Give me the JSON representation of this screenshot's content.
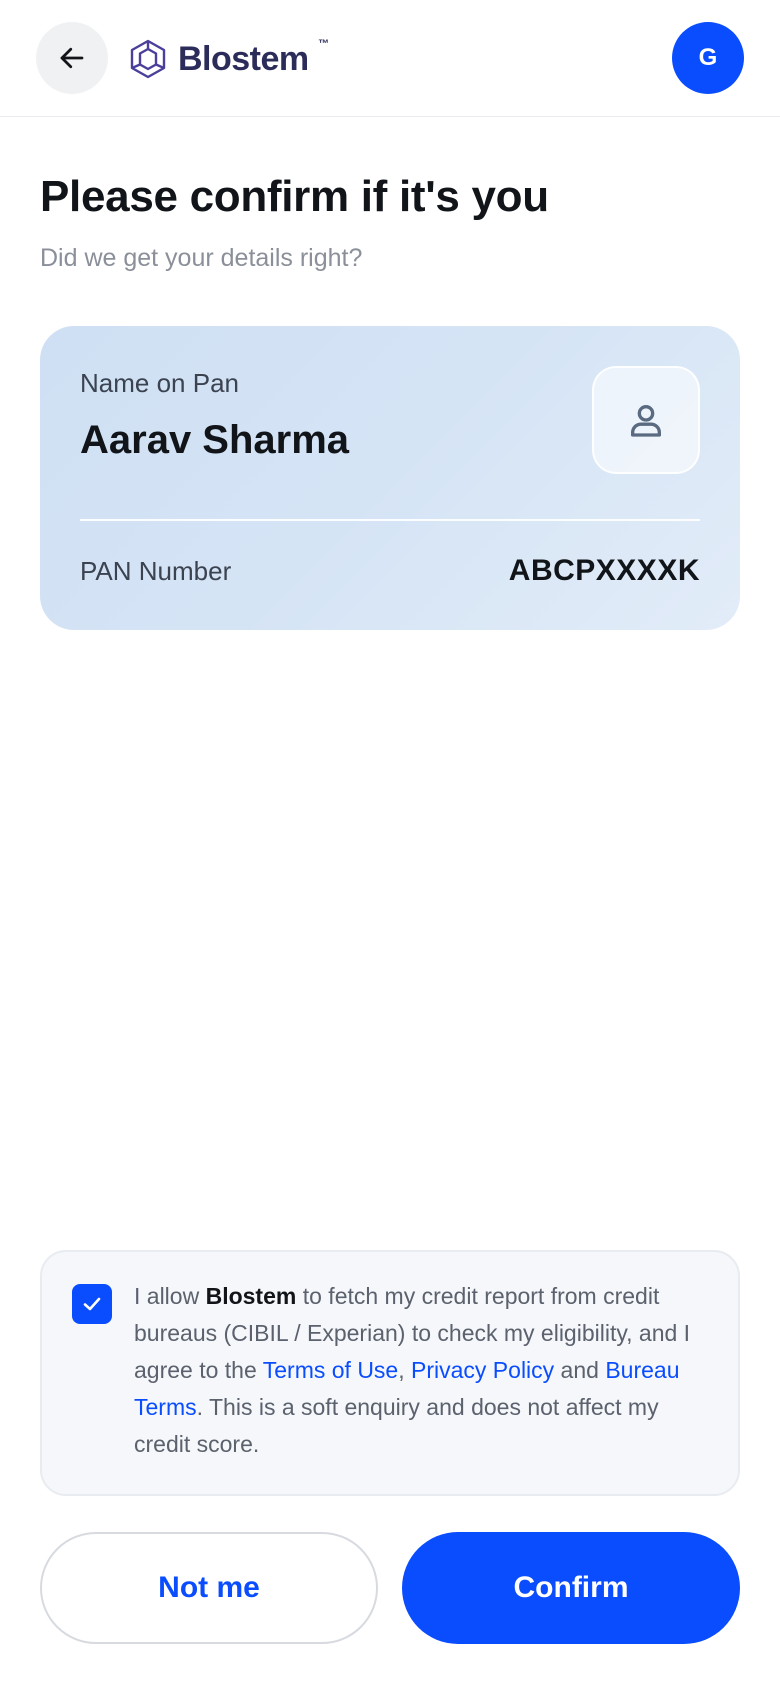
{
  "header": {
    "back_icon": "arrow-left-icon",
    "brand_name": "Blostem",
    "brand_tm": "™",
    "logo_icon": "hexagon-cube-logo",
    "avatar_initial": "G",
    "avatar_color": "#0a4dff"
  },
  "main": {
    "title": "Please confirm if it's you",
    "subtitle": "Did we get your details right?"
  },
  "pan_card": {
    "name_label": "Name on Pan",
    "name_value": "Aarav Sharma",
    "avatar_icon": "user-icon",
    "number_label": "PAN Number",
    "number_value": "ABCPXXXXK"
  },
  "consent": {
    "checked": true,
    "text_1": "I allow ",
    "brand": "Blostem",
    "text_2": " to fetch my credit report from credit bureaus (CIBIL / Experian) to check my eligibility, and I agree to the ",
    "link_terms": "Terms of Use",
    "text_3": ", ",
    "link_privacy": "Privacy Policy",
    "text_4": " and ",
    "link_bureau": "Bureau Terms",
    "text_5": ". This is a soft enquiry and does not affect my credit score."
  },
  "actions": {
    "not_me_label": "Not me",
    "confirm_label": "Confirm"
  },
  "colors": {
    "accent": "#0a4dff",
    "brand_text": "#2c2c5a"
  }
}
